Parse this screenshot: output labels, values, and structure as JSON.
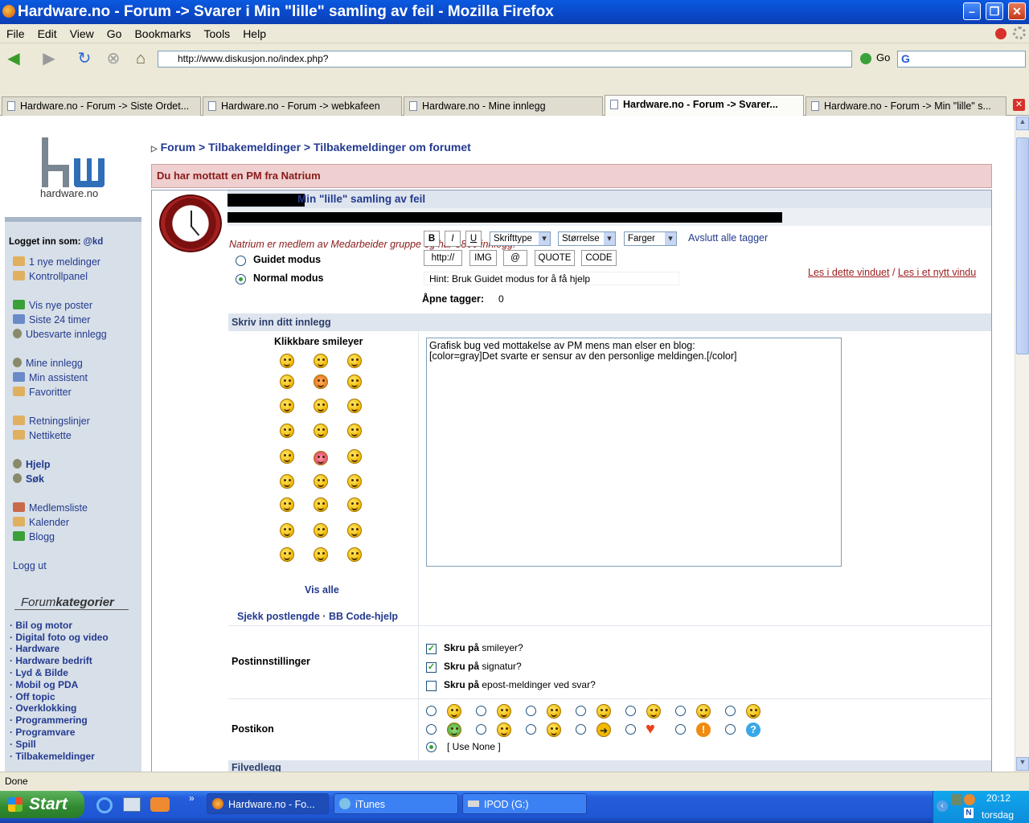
{
  "window": {
    "title": "Hardware.no - Forum -> Svarer i Min \"lille\" samling av feil - Mozilla Firefox"
  },
  "menu": [
    "File",
    "Edit",
    "View",
    "Go",
    "Bookmarks",
    "Tools",
    "Help"
  ],
  "toolbar": {
    "url": "http://www.diskusjon.no/index.php?",
    "go_label": "Go"
  },
  "tabs": [
    {
      "label": "Hardware.no - Forum -> Siste Ordet...",
      "active": false
    },
    {
      "label": "Hardware.no - Forum -> webkafeen",
      "active": false
    },
    {
      "label": "Hardware.no - Mine innlegg",
      "active": false
    },
    {
      "label": "Hardware.no - Forum -> Svarer...",
      "active": true
    },
    {
      "label": "Hardware.no - Forum -> Min \"lille\" s...",
      "active": false
    }
  ],
  "sidebar": {
    "logo_text": "hardware.no",
    "logged_in_label": "Logget inn som:",
    "user": "@kd",
    "links": [
      "1 nye meldinger",
      "Kontrollpanel",
      "Vis nye poster",
      "Siste 24 timer",
      "Ubesvarte innlegg",
      "Mine innlegg",
      "Min assistent",
      "Favoritter",
      "Retningslinjer",
      "Nettikette",
      "Hjelp",
      "Søk",
      "Medlemsliste",
      "Kalender",
      "Blogg",
      "Logg ut"
    ],
    "categories_title_a": "Forum",
    "categories_title_b": "kategorier",
    "categories": [
      "Bil og motor",
      "Digital foto og video",
      "Hardware",
      "Hardware bedrift",
      "Lyd & Bilde",
      "Mobil og PDA",
      "Off topic",
      "Overklokking",
      "Programmering",
      "Programvare",
      "Spill",
      "Tilbakemeldinger"
    ]
  },
  "breadcrumb": {
    "root": "Forum",
    "sep": ">",
    "level1": "Tilbakemeldinger",
    "level2": "Tilbakemeldinger om forumet"
  },
  "pm_notice": "Du har mottatt en PM fra Natrium",
  "topic_title": "Min \"lille\" samling av feil",
  "member_note": "Natrium er medlem av Medarbeider gruppe og har 3866 innlegg.",
  "editor": {
    "mode_guided": "Guidet modus",
    "mode_normal": "Normal modus",
    "btn_bold": "B",
    "btn_italic": "I",
    "btn_underline": "U",
    "select_font": "Skrifttype",
    "select_size": "Størrelse",
    "select_color": "Farger",
    "close_tags": "Avslutt alle tagger",
    "btn_url": "http://",
    "btn_img": "IMG",
    "btn_email": "@",
    "btn_quote": "QUOTE",
    "btn_code": "CODE",
    "hint": "Hint: Bruk Guidet modus for å få hjelp",
    "open_tags_label": "Åpne tagger:",
    "open_tags_value": "0",
    "read_here": "Les i dette vinduet",
    "read_sep": "/",
    "read_new": "Les i et nytt vindu",
    "section_title": "Skriv inn ditt innlegg",
    "smileys_title": "Klikkbare smileyer",
    "show_all": "Vis alle",
    "check_length": "Sjekk postlengde",
    "dot": "·",
    "bbcode_help": "BB Code-hjelp",
    "text_line1": "Grafisk bug ved mottakelse av PM mens man elser en blog:",
    "text_line2": "[color=gray]Det svarte er sensur av den personlige meldingen.[/color]"
  },
  "post_options": {
    "label": "Postinnstillinger",
    "prefix": "Skru på",
    "opt1": "smileyer?",
    "opt1_checked": true,
    "opt2": "signatur?",
    "opt2_checked": true,
    "opt3": "epost-meldinger ved svar?",
    "opt3_checked": false
  },
  "post_icons": {
    "label": "Postikon",
    "none_label": "[ Use None ]"
  },
  "attachments_label": "Filvedlegg",
  "status": "Done",
  "taskbar": {
    "start": "Start",
    "items": [
      "Hardware.no - Fo...",
      "iTunes",
      "IPOD (G:)"
    ],
    "time": "20:12",
    "day": "torsdag"
  }
}
